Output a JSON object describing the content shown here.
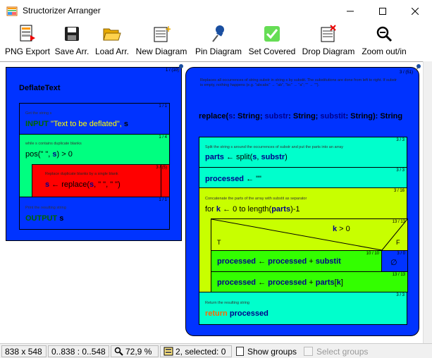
{
  "window": {
    "title": "Structorizer Arranger",
    "minimize_glyph": "—",
    "maximize_glyph": "☐",
    "close_glyph": "✕"
  },
  "toolbar": {
    "buttons": [
      {
        "label": "PNG Export",
        "icon": "png-export-icon"
      },
      {
        "label": "Save Arr.",
        "icon": "save-icon"
      },
      {
        "label": "Load Arr.",
        "icon": "folder-open-icon"
      },
      {
        "label": "New Diagram",
        "icon": "new-diagram-icon"
      },
      {
        "label": "Pin Diagram",
        "icon": "pin-icon"
      },
      {
        "label": "Set Covered",
        "icon": "checkmark-icon"
      },
      {
        "label": "Drop Diagram",
        "icon": "drop-diagram-icon"
      },
      {
        "label": "Zoom out/in",
        "icon": "zoom-icon"
      }
    ]
  },
  "diagram1": {
    "counter": "1 / (10)",
    "title": "DeflateText",
    "input": {
      "counter": "1 / 1",
      "comment": "Get the string s",
      "keyword": "INPUT",
      "text": " \"Text to be deflated\", ",
      "var": "s"
    },
    "while": {
      "counter": "1 / 4",
      "comment": "while s contains duplicate blanks",
      "cond_pre": "pos(\"  \", ",
      "cond_var": "s",
      "cond_post": ") > 0",
      "body": {
        "counter": "3 / (5)",
        "comment": "Replace duplicate blanks by a single blank",
        "var": "s",
        "assign": " ← replace(",
        "var2": "s",
        "args": ", \"  \", \" \")"
      }
    },
    "output": {
      "counter": "1 / 1",
      "comment": "Print the resulting string",
      "keyword": "OUTPUT",
      "var": " s"
    }
  },
  "diagram2": {
    "counter": "3 / (51)",
    "comment": "Replaces all occurrences of string substr in string s by substit. The substitutions are done from left to right. If substr is empty, nothing happens (e.g. \"abcabc\" → \"ab\", \"bc\" → \"a\"; \"\" → \"\").",
    "header_name": "replace(",
    "header_params": [
      {
        "name": "s",
        "type": ": String; "
      },
      {
        "name": "substr",
        "type": ": String; "
      },
      {
        "name": "substit",
        "type": ": String): String"
      }
    ],
    "split": {
      "counter": "3 / 3",
      "comment": "Split the string s around the occurrences of substr and put the parts into an array",
      "var": "parts",
      "text": " ← split(",
      "a1": "s",
      "sep": ", ",
      "a2": "substr",
      "close": ")"
    },
    "init": {
      "counter": "3 / 3",
      "var": "processed",
      "text": " ← \"\""
    },
    "for": {
      "counter": "3 / 16",
      "comment": "Concatenate the parts of the array with substit as separator",
      "kw": "for ",
      "var": "k",
      "text": " ← 0 to length(",
      "var2": "parts",
      "end": ")-1",
      "if": {
        "counter": "13 / 13",
        "cond_var": "k",
        "cond": " > 0",
        "true_label": "T",
        "false_label": "F",
        "then": {
          "counter": "10 / 10",
          "var": "processed",
          "text": " ← ",
          "var2": "processed",
          "plus": " + ",
          "var3": "substit"
        },
        "else": {
          "counter": "3 / 0",
          "glyph": "∅"
        }
      },
      "concat": {
        "counter": "13 / 13",
        "var": "processed",
        "text": " ← ",
        "var2": "processed",
        "plus": " + ",
        "var3": "parts",
        "idx_open": "[",
        "idx": "k",
        "idx_close": "]"
      }
    },
    "return": {
      "counter": "3 / 3",
      "comment": "Return the resulting string",
      "kw": "return ",
      "var": "processed"
    }
  },
  "statusbar": {
    "size": "838 x 548",
    "range": "0..838 : 0..548",
    "zoom": "72,9 %",
    "selection": "2, selected: 0",
    "show_groups": "Show groups",
    "select_groups": "Select groups"
  },
  "colors": {
    "blue": "#0033ff",
    "green": "#00ff80",
    "red": "#ff0000",
    "cyan": "#00ffcc",
    "yellowgreen": "#c8ff00",
    "lime": "#33ff00"
  }
}
